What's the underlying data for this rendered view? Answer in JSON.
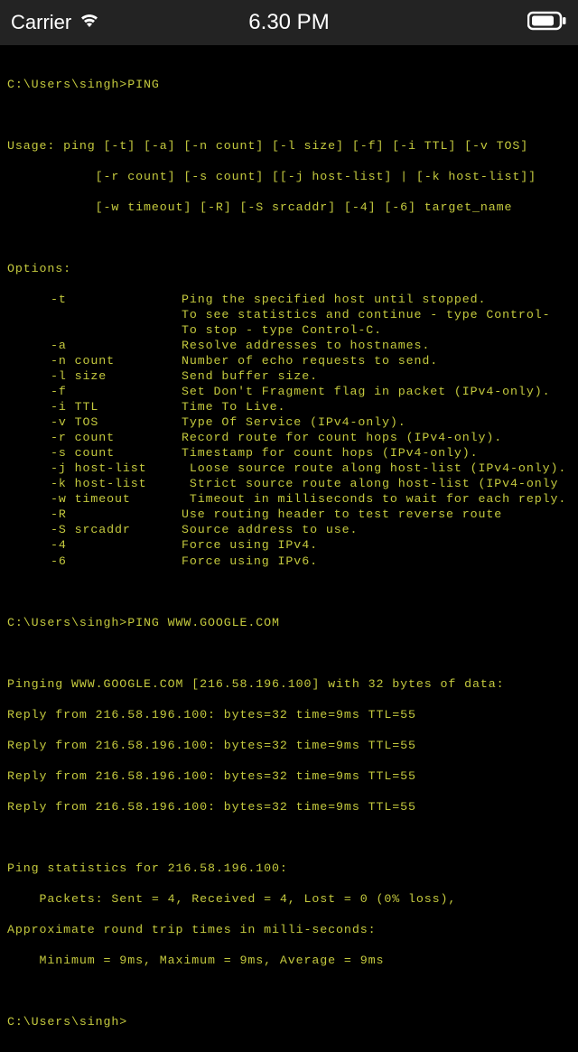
{
  "status_bar": {
    "carrier": "Carrier",
    "time": "6.30 PM"
  },
  "terminal": {
    "prompt1": "C:\\Users\\singh>PING",
    "usage1": "Usage: ping [-t] [-a] [-n count] [-l size] [-f] [-i TTL] [-v TOS]",
    "usage2": "           [-r count] [-s count] [[-j host-list] | [-k host-list]]",
    "usage3": "           [-w timeout] [-R] [-S srcaddr] [-4] [-6] target_name",
    "options_header": "Options:",
    "opts": [
      {
        "flag": "-t",
        "desc": "Ping the specified host until stopped."
      },
      {
        "flag": "",
        "desc": "To see statistics and continue - type Control-"
      },
      {
        "flag": "",
        "desc": "To stop - type Control-C."
      },
      {
        "flag": "-a",
        "desc": "Resolve addresses to hostnames."
      },
      {
        "flag": "-n count",
        "desc": "Number of echo requests to send."
      },
      {
        "flag": "-l size",
        "desc": "Send buffer size."
      },
      {
        "flag": "-f",
        "desc": "Set Don't Fragment flag in packet (IPv4-only)."
      },
      {
        "flag": "-i TTL",
        "desc": "Time To Live."
      },
      {
        "flag": "-v TOS",
        "desc": "Type Of Service (IPv4-only)."
      },
      {
        "flag": "-r count",
        "desc": "Record route for count hops (IPv4-only)."
      },
      {
        "flag": "-s count",
        "desc": "Timestamp for count hops (IPv4-only)."
      },
      {
        "flag": "-j host-list",
        "desc": " Loose source route along host-list (IPv4-only)."
      },
      {
        "flag": "-k host-list",
        "desc": " Strict source route along host-list (IPv4-only"
      },
      {
        "flag": "-w timeout",
        "desc": " Timeout in milliseconds to wait for each reply."
      },
      {
        "flag": "-R",
        "desc": "Use routing header to test reverse route"
      },
      {
        "flag": "-S srcaddr",
        "desc": "Source address to use."
      },
      {
        "flag": "-4",
        "desc": "Force using IPv4."
      },
      {
        "flag": "-6",
        "desc": "Force using IPv6."
      }
    ],
    "prompt2": "C:\\Users\\singh>PING WWW.GOOGLE.COM",
    "pinging": "Pinging WWW.GOOGLE.COM [216.58.196.100] with 32 bytes of data:",
    "reply1": "Reply from 216.58.196.100: bytes=32 time=9ms TTL=55",
    "reply2": "Reply from 216.58.196.100: bytes=32 time=9ms TTL=55",
    "reply3": "Reply from 216.58.196.100: bytes=32 time=9ms TTL=55",
    "reply4": "Reply from 216.58.196.100: bytes=32 time=9ms TTL=55",
    "stats1": "Ping statistics for 216.58.196.100:",
    "stats2": "    Packets: Sent = 4, Received = 4, Lost = 0 (0% loss),",
    "stats3": "Approximate round trip times in milli-seconds:",
    "stats4": "    Minimum = 9ms, Maximum = 9ms, Average = 9ms",
    "prompt3": "C:\\Users\\singh>"
  }
}
